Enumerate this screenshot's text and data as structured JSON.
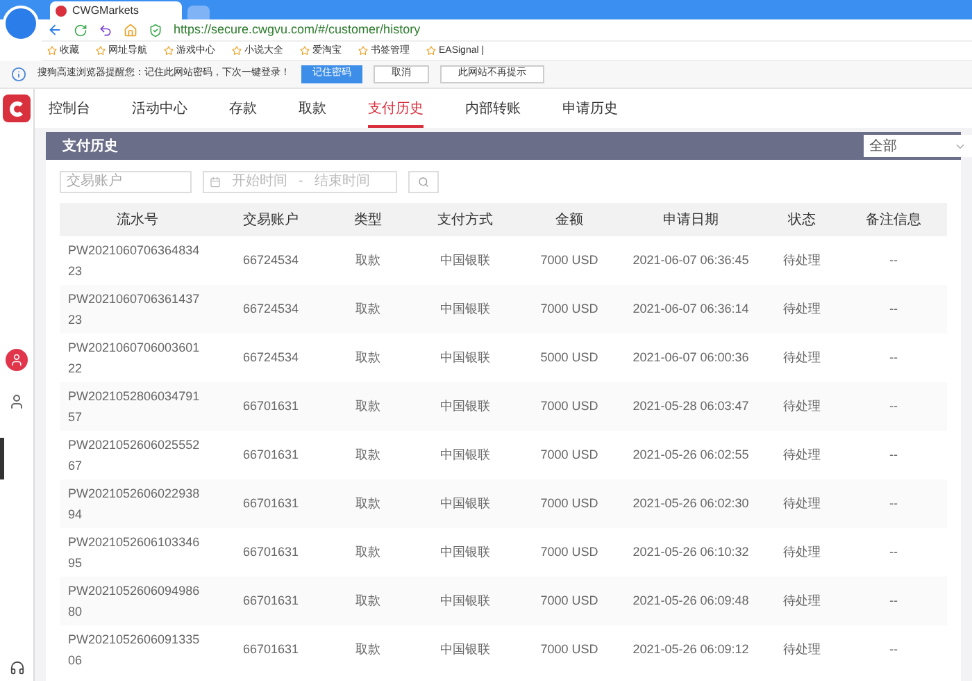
{
  "browser": {
    "tab_title": "CWGMarkets",
    "url": "https://secure.cwgvu.com/#/customer/history",
    "bookmarks": [
      "收藏",
      "网址导航",
      "游戏中心",
      "小说大全",
      "爱淘宝",
      "书签管理",
      "EASignal |"
    ],
    "password_prompt": {
      "message": "搜狗高速浏览器提醒您：记住此网站密码，下次一键登录！",
      "buttons": [
        {
          "label": "记住密码",
          "kind": "primary"
        },
        {
          "label": "取消",
          "kind": "plain"
        },
        {
          "label": "此网站不再提示",
          "kind": "plain"
        }
      ]
    }
  },
  "nav": [
    {
      "label": "控制台",
      "selected": false
    },
    {
      "label": "活动中心",
      "selected": false
    },
    {
      "label": "存款",
      "selected": false
    },
    {
      "label": "取款",
      "selected": false
    },
    {
      "label": "支付历史",
      "selected": true
    },
    {
      "label": "内部转账",
      "selected": false
    },
    {
      "label": "申请历史",
      "selected": false
    }
  ],
  "panel": {
    "title": "支付历史",
    "filter_select": "全部"
  },
  "filters": {
    "account": {
      "placeholder": "交易账户"
    },
    "start": {
      "placeholder": "开始时间"
    },
    "separator": "-",
    "end": {
      "placeholder": "结束时间"
    }
  },
  "table": {
    "columns": [
      "流水号",
      "交易账户",
      "类型",
      "支付方式",
      "金额",
      "申请日期",
      "状态",
      "备注信息"
    ],
    "rows": [
      [
        "PW202106070636483423",
        "66724534",
        "取款",
        "中国银联",
        "7000 USD",
        "2021-06-07 06:36:45",
        "待处理",
        "--"
      ],
      [
        "PW202106070636143723",
        "66724534",
        "取款",
        "中国银联",
        "7000 USD",
        "2021-06-07 06:36:14",
        "待处理",
        "--"
      ],
      [
        "PW202106070600360122",
        "66724534",
        "取款",
        "中国银联",
        "5000 USD",
        "2021-06-07 06:00:36",
        "待处理",
        "--"
      ],
      [
        "PW202105280603479157",
        "66701631",
        "取款",
        "中国银联",
        "7000 USD",
        "2021-05-28 06:03:47",
        "待处理",
        "--"
      ],
      [
        "PW202105260602555267",
        "66701631",
        "取款",
        "中国银联",
        "7000 USD",
        "2021-05-26 06:02:55",
        "待处理",
        "--"
      ],
      [
        "PW202105260602293894",
        "66701631",
        "取款",
        "中国银联",
        "7000 USD",
        "2021-05-26 06:02:30",
        "待处理",
        "--"
      ],
      [
        "PW202105260610334695",
        "66701631",
        "取款",
        "中国银联",
        "7000 USD",
        "2021-05-26 06:10:32",
        "待处理",
        "--"
      ],
      [
        "PW202105260609498680",
        "66701631",
        "取款",
        "中国银联",
        "7000 USD",
        "2021-05-26 06:09:48",
        "待处理",
        "--"
      ],
      [
        "PW202105260609133506",
        "66701631",
        "取款",
        "中国银联",
        "7000 USD",
        "2021-05-26 06:09:12",
        "待处理",
        "--"
      ]
    ]
  }
}
